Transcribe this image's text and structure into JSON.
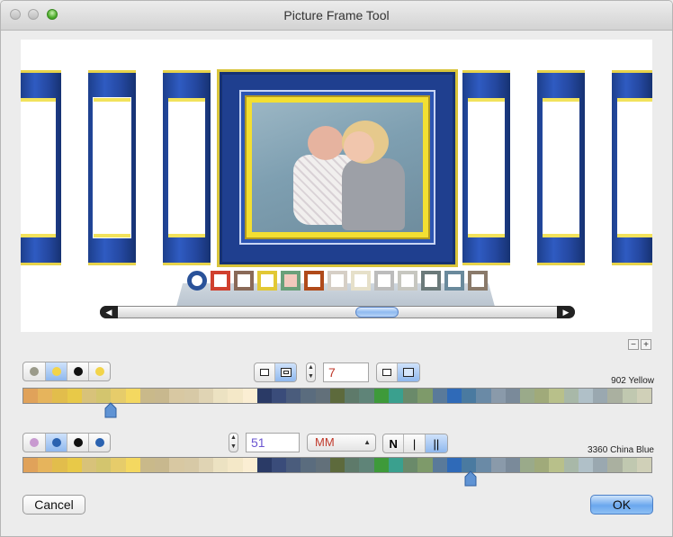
{
  "window": {
    "title": "Picture Frame Tool"
  },
  "preview": {
    "frame_swatches": [
      {
        "border": "#2a5299",
        "fill": "#ffffff"
      },
      {
        "border": "#d0402e",
        "fill": "#ffffff"
      },
      {
        "border": "#8a6a58",
        "fill": "#ffffff"
      },
      {
        "border": "#e2c835",
        "fill": "#ffffff"
      },
      {
        "border": "#6aa07a",
        "fill": "#f3c9bd"
      },
      {
        "border": "#b04a1a",
        "fill": "#ffffff"
      },
      {
        "border": "#d6cfc6",
        "fill": "#ffffff"
      },
      {
        "border": "#e6e0c9",
        "fill": "#ffffff"
      },
      {
        "border": "#bcbcbc",
        "fill": "#ffffff"
      },
      {
        "border": "#c7c7c0",
        "fill": "#ffffff"
      },
      {
        "border": "#6b7a7a",
        "fill": "#ffffff"
      },
      {
        "border": "#6a8a9c",
        "fill": "#ffffff"
      },
      {
        "border": "#8a7a6a",
        "fill": "#ffffff"
      }
    ],
    "scroll_position": 0.6
  },
  "zoom": {
    "minus": "−",
    "plus": "+"
  },
  "row1": {
    "dots": [
      "#9a9a8a",
      "#f2d44a",
      "#111111",
      "#f2d44a"
    ],
    "dots_selected": 1,
    "stepper_value": "7",
    "color_name": "902 Yellow",
    "pin_position": 0.14
  },
  "row2": {
    "dots": [
      "#c89ad0",
      "#2a62b0",
      "#111111",
      "#2a62b0"
    ],
    "dots_selected": 1,
    "width_value": "51",
    "unit_selected": "MM",
    "style_labels": [
      "N",
      "|",
      "||"
    ],
    "color_name": "3360 China Blue",
    "pin_position": 0.711
  },
  "palette": [
    "#e0a25a",
    "#e6b45c",
    "#e2bd4c",
    "#e8c948",
    "#d8c27a",
    "#d3c56e",
    "#e6cc6a",
    "#f4d860",
    "#c9b98a",
    "#c8b88e",
    "#d8c8a2",
    "#d7c9a6",
    "#e0d4b4",
    "#ece2c2",
    "#f4e8c8",
    "#fbeed3",
    "#2a3a66",
    "#3a4c7a",
    "#4a5c7c",
    "#5a6c7e",
    "#62707a",
    "#5d6a3c",
    "#5e7a6a",
    "#5f8478",
    "#3e9a3a",
    "#3aa08e",
    "#6a8a6a",
    "#7e9a6a",
    "#5a7a9a",
    "#2f6ab8",
    "#4a7aa0",
    "#6a8aa6",
    "#8a9aaa",
    "#7a8a9a",
    "#9aaa8a",
    "#a0aa7a",
    "#b8c08a",
    "#a8b8a8",
    "#b0c0c8",
    "#9aa8b0",
    "#aab0a0",
    "#c0c8b0",
    "#d0d0b8"
  ],
  "buttons": {
    "cancel": "Cancel",
    "ok": "OK"
  }
}
